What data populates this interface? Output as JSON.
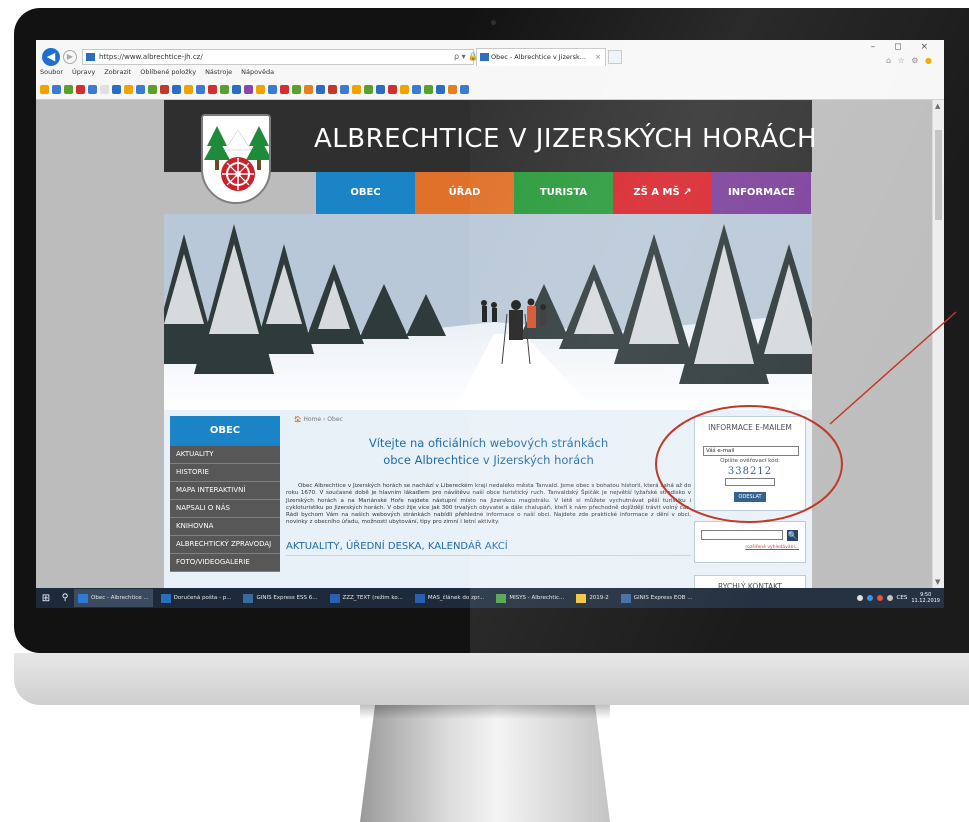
{
  "browser": {
    "address": "https://www.albrechtice-jh.cz/",
    "address_tools": "ρ ▾ 🔒 C",
    "tab_title": "Obec - Albrechtice v Jizersk...",
    "tab_close": "×",
    "window_controls": "– ◻ ×",
    "menu": [
      "Soubor",
      "Úpravy",
      "Zobrazit",
      "Oblíbené položky",
      "Nástroje",
      "Nápověda"
    ]
  },
  "site": {
    "title": "ALBRECHTICE V JIZERSKÝCH HORÁCH",
    "menu": [
      {
        "label": "OBEC",
        "color": "#1a84c6"
      },
      {
        "label": "ÚŘAD",
        "color": "#e0712a"
      },
      {
        "label": "TURISTA",
        "color": "#2a9b3c"
      },
      {
        "label": "ZŠ A MŠ ↗",
        "color": "#d8242d"
      },
      {
        "label": "INFORMACE",
        "color": "#7a3f9a"
      }
    ]
  },
  "sidebar": {
    "head": "OBEC",
    "items": [
      "AKTUALITY",
      "HISTORIE",
      "MAPA INTERAKTIVNÍ",
      "NAPSALI O NÁS",
      "KNIHOVNA",
      "ALBRECHTICKÝ ZPRAVODAJ",
      "FOTO/VIDEOGALERIE"
    ]
  },
  "main": {
    "breadcrumb": "🏠 Home › Obec",
    "welcome_line1": "Vítejte na oficiálních webových stránkách",
    "welcome_line2": "obce Albrechtice v Jizerských horách",
    "intro": "Obec Albrechtice v Jizerských horách se nachází v Libereckém kraji nedaleko města Tanvald. Jsme obec s bohatou historií, která sahá až do roku 1670. V současné době je hlavním lákadlem pro návštěvu naší obce turistický ruch. Tanvaldský Špičák je největší lyžařské středisko v Jizerských horách a na Mariánské Hoře najdete nástupní místo na Jizerskou magistrálu. V létě si můžete vychutnávat pěší turistiku i cykloturistiku po Jizerských horách. V obci žije více jak 300 trvalých obyvatel a dále chalupáři, kteří k nám přechodně dojíždějí trávit volný čas. Rádi bychom Vám na našich webových stránkách nabídli přehledné informace o naší obci. Najdete zde praktické informace z dění v obci, novinky z obecního úřadu, možnosti ubytování, tipy pro zimní i letní aktivity.",
    "section_title": "AKTUALITY, ÚŘEDNÍ DESKA, KALENDÁŘ AKCÍ"
  },
  "right": {
    "email_title": "INFORMACE E-MAILEM",
    "email_placeholder": "Váš e-mail",
    "verify_label": "Opište ověřovací kód:",
    "captcha": "338212",
    "send_label": "ODESLAT",
    "search_icon": "🔍",
    "advanced_search": "rozšířené vyhledávání...",
    "quick_contact": "RYCHLÝ KONTAKT"
  },
  "taskbar": {
    "items": [
      {
        "label": "Obec - Albrechtice ...",
        "color": "#2d7bd6",
        "active": true
      },
      {
        "label": "Doručená pošta - p...",
        "color": "#2a6fc1",
        "active": false
      },
      {
        "label": "GINIS Express ESS 6...",
        "color": "#3b6aa0",
        "active": false
      },
      {
        "label": "ZZZ_TEXT (režim ko...",
        "color": "#2b5fb0",
        "active": false
      },
      {
        "label": "MAS_článek do zpr...",
        "color": "#2b5fb0",
        "active": false
      },
      {
        "label": "MISYS - Albrechtic...",
        "color": "#4aa04a",
        "active": false
      },
      {
        "label": "2019-2",
        "color": "#f2c438",
        "active": false
      },
      {
        "label": "GINIS Express EOB ...",
        "color": "#3b6aa0",
        "active": false
      }
    ],
    "tray_lang": "CES",
    "time": "9:50",
    "date": "11.12.2019"
  },
  "colors": {
    "annotation": "#c0392b",
    "accent_blue": "#1a84c6"
  }
}
